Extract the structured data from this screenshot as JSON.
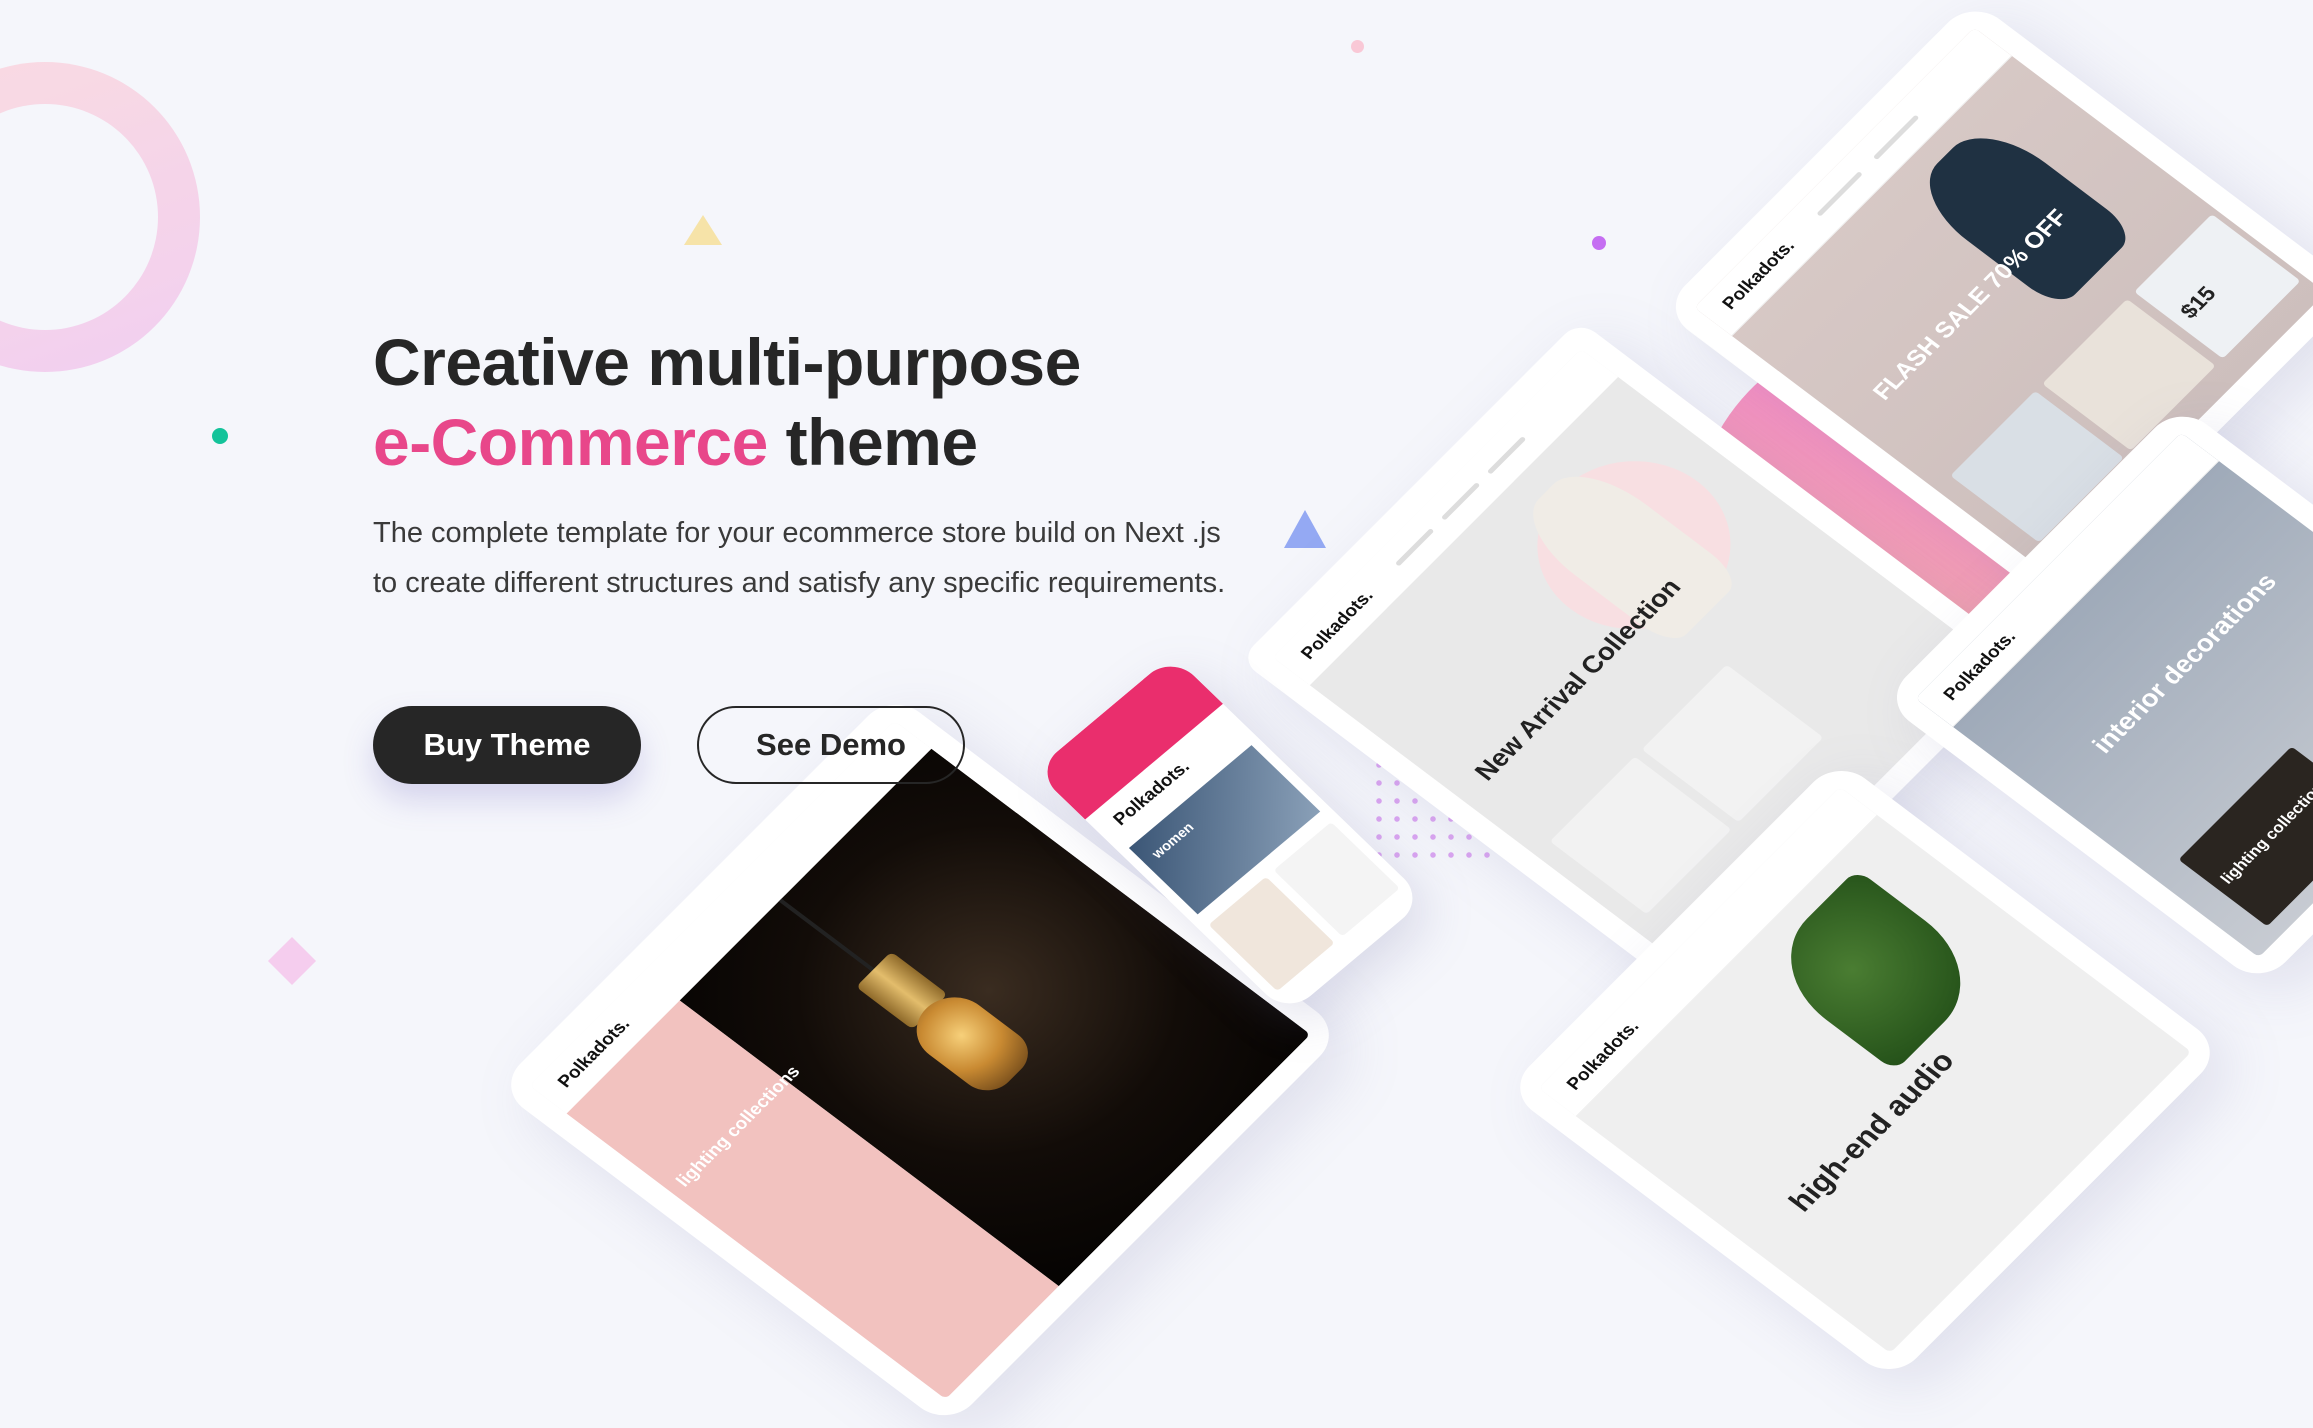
{
  "hero": {
    "title_line1": "Creative multi-purpose",
    "title_highlight": "e-Commerce",
    "title_rest": " theme",
    "description": "The complete template for your ecommerce store build on Next .js to create different structures and satisfy any specific requirements."
  },
  "buttons": {
    "buy": "Buy Theme",
    "demo": "See Demo"
  },
  "mockups": {
    "brand": "Polkadots.",
    "laptop_heading": "New Arrival Collection",
    "tablet_heading": "FLASH SALE 70% OFF",
    "tablet_price": "$15",
    "lamp_heading": "lighting collections",
    "interior_heading": "interior decorations",
    "interior_sub": "lighting collections",
    "audio_heading": "high-end audio",
    "phone_section": "women"
  },
  "colors": {
    "accent": "#e8478a",
    "text": "#262626",
    "background": "#f5f6fb"
  }
}
